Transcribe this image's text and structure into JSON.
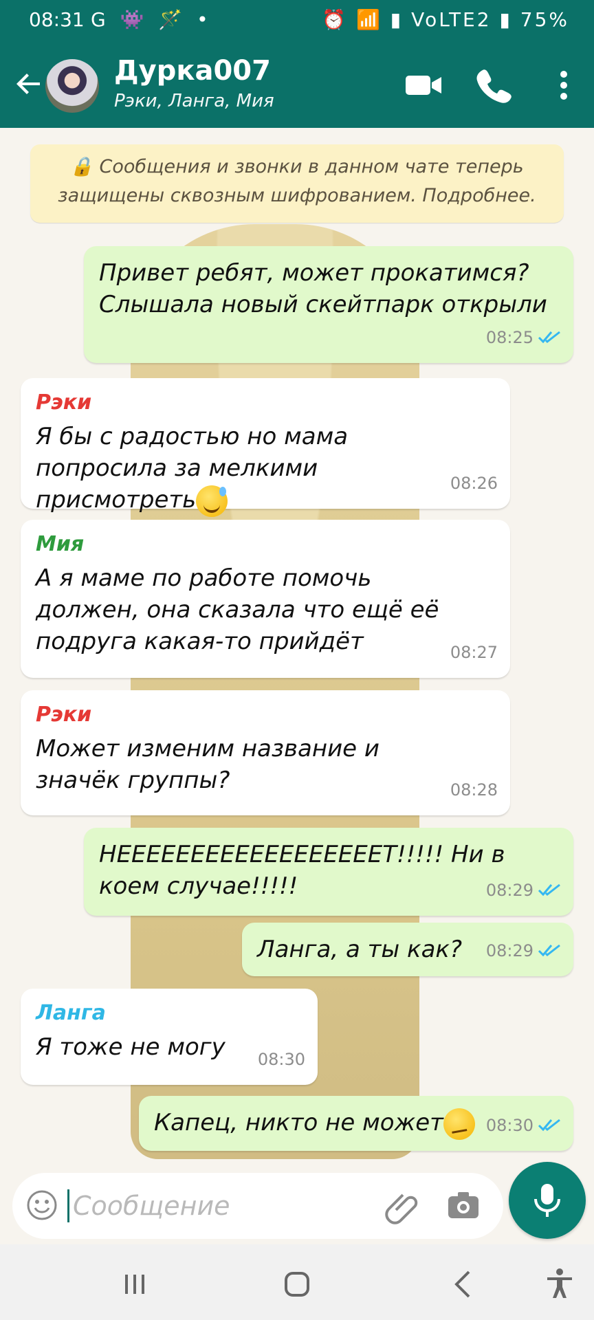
{
  "status_bar": {
    "time": "08:31",
    "left_icons": "G 👾 🪄 •",
    "right": "⏰ 📶 ▮ VoLTE2 ▮ 75%"
  },
  "header": {
    "title": "Дурка007",
    "subtitle": "Рэки, Ланга, Мия"
  },
  "encryption_notice": "🔒 Сообщения и звонки в данном чате теперь защищены сквозным шифрованием. Подробнее.",
  "messages": [
    {
      "dir": "out",
      "text": "Привет ребят, может прокатимся? Слышала новый скейтпарк открыли",
      "time": "08:25"
    },
    {
      "dir": "in",
      "sender": "Рэки",
      "sender_color": "#e53935",
      "text": "Я бы с радостью но мама попросила за мелкими присмотреть",
      "time": "08:26"
    },
    {
      "dir": "in",
      "sender": "Мия",
      "sender_color": "#2e9b3d",
      "text": "А я маме по работе помочь должен, она сказала что ещё её подруга какая-то прийдёт",
      "time": "08:27"
    },
    {
      "dir": "in",
      "sender": "Рэки",
      "sender_color": "#e53935",
      "text": "Может изменим название и значёк группы?",
      "time": "08:28"
    },
    {
      "dir": "out",
      "text": "НЕЕЕЕЕЕЕЕЕЕЕЕЕЕЕЕЕЕТ!!!!! Ни в коем случае!!!!!",
      "time": "08:29"
    },
    {
      "dir": "out",
      "text": "Ланга, а ты как?",
      "time": "08:29"
    },
    {
      "dir": "in",
      "sender": "Ланга",
      "sender_color": "#2fb7e5",
      "text": "Я тоже не могу",
      "time": "08:30"
    },
    {
      "dir": "out",
      "text": "Капец, никто не может",
      "time": "08:30"
    }
  ],
  "input": {
    "placeholder": "Сообщение"
  },
  "colors": {
    "header": "#0b7168",
    "outgoing_bubble": "#e1f9cb",
    "incoming_bubble": "#ffffff",
    "read_ticks": "#34b7f1",
    "notice_bg": "#fcf2c6"
  },
  "icons": {
    "back": "arrow-left-icon",
    "video": "video-camera-icon",
    "phone": "phone-icon",
    "menu": "more-vertical-icon",
    "emoji": "emoji-icon",
    "attach": "paperclip-icon",
    "camera": "camera-icon",
    "mic": "microphone-icon",
    "recents": "recent-apps-icon",
    "home": "home-icon",
    "back_nav": "back-nav-icon",
    "accessibility": "accessibility-icon"
  }
}
